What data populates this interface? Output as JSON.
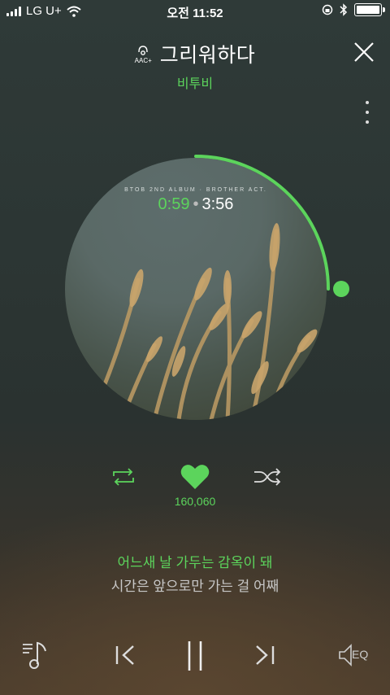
{
  "status_bar": {
    "carrier": "LG U+",
    "time": "오전 11:52",
    "battery_level": 1.0
  },
  "player": {
    "quality_badge": "AAC+",
    "title": "그리워하다",
    "artist": "비투비",
    "album_label": "BTOB 2ND ALBUM · BROTHER ACT.",
    "current_time": "0:59",
    "separator": "•",
    "total_time": "3:56",
    "progress_fraction": 0.25,
    "like_count": "160,060",
    "lyrics": {
      "current": "어느새 날 가두는 감옥이 돼",
      "next": "시간은 앞으로만 가는 걸 어째"
    },
    "eq_label": "EQ"
  },
  "colors": {
    "accent": "#5cd45c",
    "text": "#ffffff",
    "muted": "#c8c8c8"
  },
  "icons": [
    "signal-icon",
    "wifi-icon",
    "rotation-lock-icon",
    "bluetooth-icon",
    "battery-icon",
    "aac-headphone-icon",
    "close-icon",
    "more-vertical-icon",
    "repeat-icon",
    "heart-icon",
    "shuffle-icon",
    "playlist-icon",
    "previous-icon",
    "pause-icon",
    "next-icon",
    "eq-speaker-icon"
  ]
}
